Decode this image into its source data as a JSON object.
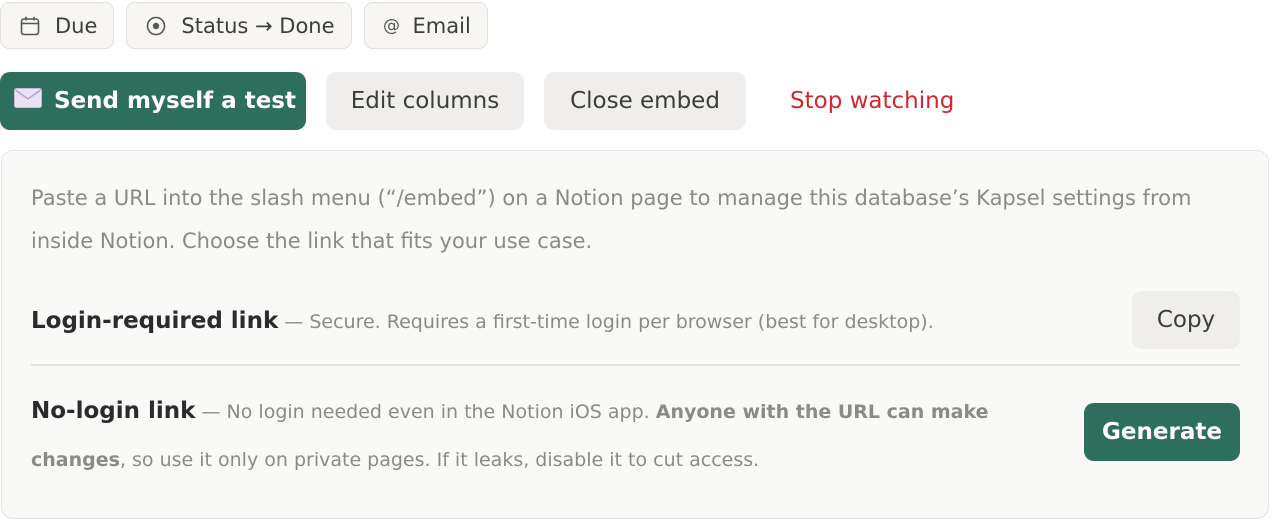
{
  "chips": [
    {
      "label": "Due",
      "icon": "calendar-icon"
    },
    {
      "label": "Status → Done",
      "icon": "radio-circle-icon"
    },
    {
      "label": "Email",
      "icon": "at-sign-icon",
      "glyph": "@"
    }
  ],
  "actions": {
    "send_test_label": "Send myself a test",
    "send_test_icon": "envelope-icon",
    "send_test_glyph": "✉",
    "edit_columns_label": "Edit columns",
    "close_embed_label": "Close embed",
    "stop_watching_label": "Stop watching"
  },
  "embed_panel": {
    "intro": "Paste a URL into the slash menu (“/embed”) on a Notion page to manage this database’s Kapsel settings from inside Notion. Choose the link that fits your use case.",
    "login_required": {
      "title": "Login-required link",
      "description": " — Secure. Requires a first-time login per browser (best for desktop).",
      "button_label": "Copy"
    },
    "no_login": {
      "title": "No-login link",
      "description_before": " — No login needed even in the Notion iOS app. ",
      "description_strong": "Anyone with the URL can make changes",
      "description_after": ", so use it only on private pages. If it leaks, disable it to cut access.",
      "button_label": "Generate"
    }
  },
  "colors": {
    "primary": "#2e6e5c",
    "danger_link": "#d1282f",
    "secondary_button": "#efeeec",
    "panel_background": "#f9f9f8",
    "muted_text": "#8c8a86"
  }
}
